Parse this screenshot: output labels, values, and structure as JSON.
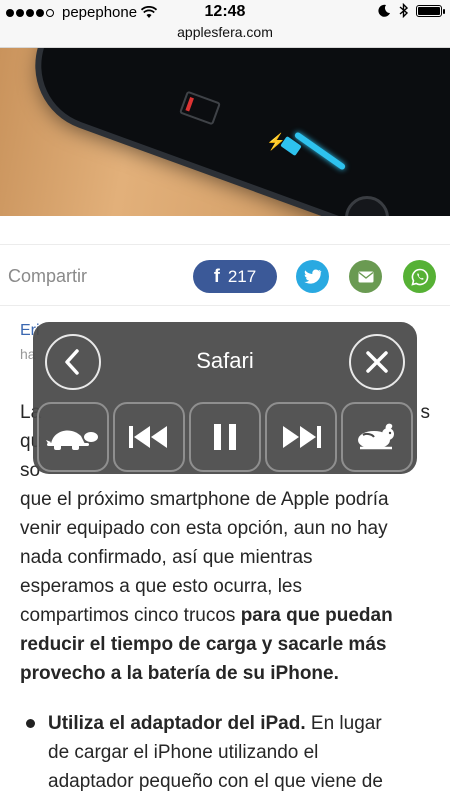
{
  "status_bar": {
    "carrier": "pepephone",
    "time": "12:48",
    "signal_bars": 4,
    "battery_level": 0.9
  },
  "url_bar": {
    "domain": "applesfera.com"
  },
  "share": {
    "label": "Compartir",
    "facebook_count": "217",
    "buttons": [
      "facebook-icon",
      "twitter-icon",
      "mail-icon",
      "whatsapp-icon"
    ]
  },
  "article": {
    "author_fragment": "Eri",
    "date_fragment": "ha",
    "para_lines": [
      "La",
      "qu",
      "so",
      "que el próximo smartphone de Apple podría",
      "venir equipado con esta opción, aun no hay",
      "nada confirmado, así que mientras",
      "esperamos a que esto ocurra, les",
      "compartimos cinco trucos "
    ],
    "para_right_fragments": [
      "s",
      "",
      ""
    ],
    "para_bold": [
      "para que puedan",
      "reducir el tiempo de carga y sacarle más",
      "provecho a la batería de su iPhone."
    ],
    "bullet_bold": "Utiliza el adaptador del iPad.",
    "bullet_text_1": " En lugar",
    "bullet_text_2": "de cargar el iPhone utilizando el",
    "bullet_text_3": "adaptador pequeño con el que viene de"
  },
  "overlay": {
    "title": "Safari",
    "controls": [
      "slower-turtle-icon",
      "previous-track-icon",
      "pause-icon",
      "next-track-icon",
      "faster-rabbit-icon"
    ]
  },
  "colors": {
    "facebook": "#3b5998",
    "twitter": "#29a9e1",
    "mail": "#6a9a52",
    "whatsapp": "#56b135",
    "link": "#3a67b0"
  }
}
